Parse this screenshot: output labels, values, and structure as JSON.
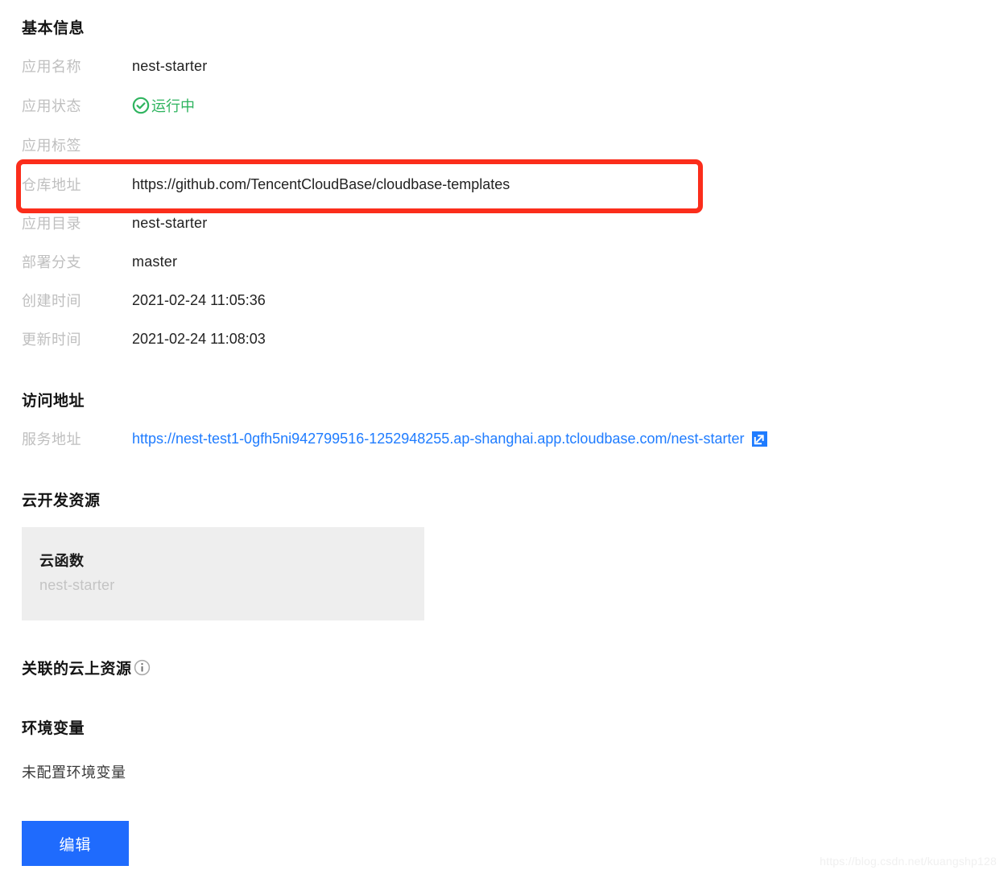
{
  "basic_info": {
    "heading": "基本信息",
    "rows": [
      {
        "label": "应用名称",
        "value": "nest-starter"
      },
      {
        "label": "应用状态",
        "value": "运行中",
        "icon": "circle-check-icon",
        "color": "#2fb45f"
      },
      {
        "label": "应用标签",
        "value": ""
      },
      {
        "label": "仓库地址",
        "value": "https://github.com/TencentCloudBase/cloudbase-templates"
      },
      {
        "label": "应用目录",
        "value": "nest-starter"
      },
      {
        "label": "部署分支",
        "value": "master"
      },
      {
        "label": "创建时间",
        "value": "2021-02-24 11:05:36"
      },
      {
        "label": "更新时间",
        "value": "2021-02-24 11:08:03"
      }
    ]
  },
  "access_address": {
    "heading": "访问地址",
    "row_label": "服务地址",
    "url": "https://nest-test1-0gfh5ni942799516-1252948255.ap-shanghai.app.tcloudbase.com/nest-starter",
    "link_color": "#1f7cff",
    "external_icon": "external-link-icon"
  },
  "cloud_resources": {
    "heading": "云开发资源",
    "card": {
      "title": "云函数",
      "subtitle": "nest-starter",
      "background": "#eeeeee"
    }
  },
  "linked_resources": {
    "heading": "关联的云上资源",
    "info_icon": "info-circle-icon"
  },
  "environment_variables": {
    "heading": "环境变量",
    "empty_text": "未配置环境变量"
  },
  "actions": {
    "edit_label": "编辑",
    "edit_color": "#1f6bfd"
  },
  "annotation": {
    "shape": "rounded-rectangle-highlight",
    "color": "#fb2d1b",
    "target_row_label": "仓库地址"
  },
  "watermark": {
    "text": "https://blog.csdn.net/kuangshp128"
  }
}
